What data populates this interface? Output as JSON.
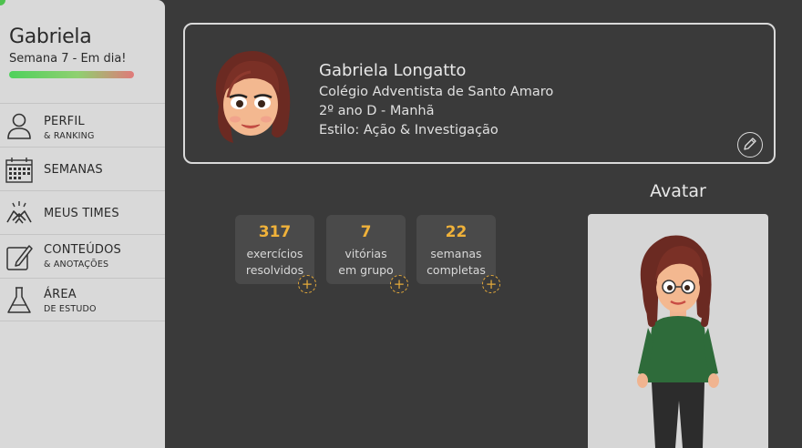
{
  "sidebar": {
    "user_name": "Gabriela",
    "week_status": "Semana 7 - Em dia!",
    "progress": 1.0,
    "items": [
      {
        "label": "PERFIL",
        "sub": "& RANKING",
        "icon": "user-icon"
      },
      {
        "label": "SEMANAS",
        "sub": "",
        "icon": "calendar-icon"
      },
      {
        "label": "MEUS TIMES",
        "sub": "",
        "icon": "handshake-icon"
      },
      {
        "label": "CONTEÚDOS",
        "sub": "& ANOTAÇÕES",
        "icon": "pencil-note-icon"
      },
      {
        "label": "ÁREA",
        "sub": "DE ESTUDO",
        "icon": "flask-icon"
      }
    ]
  },
  "profile": {
    "name": "Gabriela Longatto",
    "school": "Colégio Adventista de Santo Amaro",
    "class": "2º ano D - Manhã",
    "style": "Estilo: Ação & Investigação",
    "edit_icon": "pencil-icon"
  },
  "stats": [
    {
      "value": "317",
      "label_line1": "exercícios",
      "label_line2": "resolvidos"
    },
    {
      "value": "7",
      "label_line1": "vitórias",
      "label_line2": "em grupo"
    },
    {
      "value": "22",
      "label_line1": "semanas",
      "label_line2": "completas"
    }
  ],
  "avatar": {
    "title": "Avatar"
  },
  "colors": {
    "background": "#3a3a3a",
    "sidebar": "#d9d9d9",
    "accent": "#f0b23a",
    "progress_start": "#4fd15c",
    "progress_end": "#e07a7a"
  }
}
